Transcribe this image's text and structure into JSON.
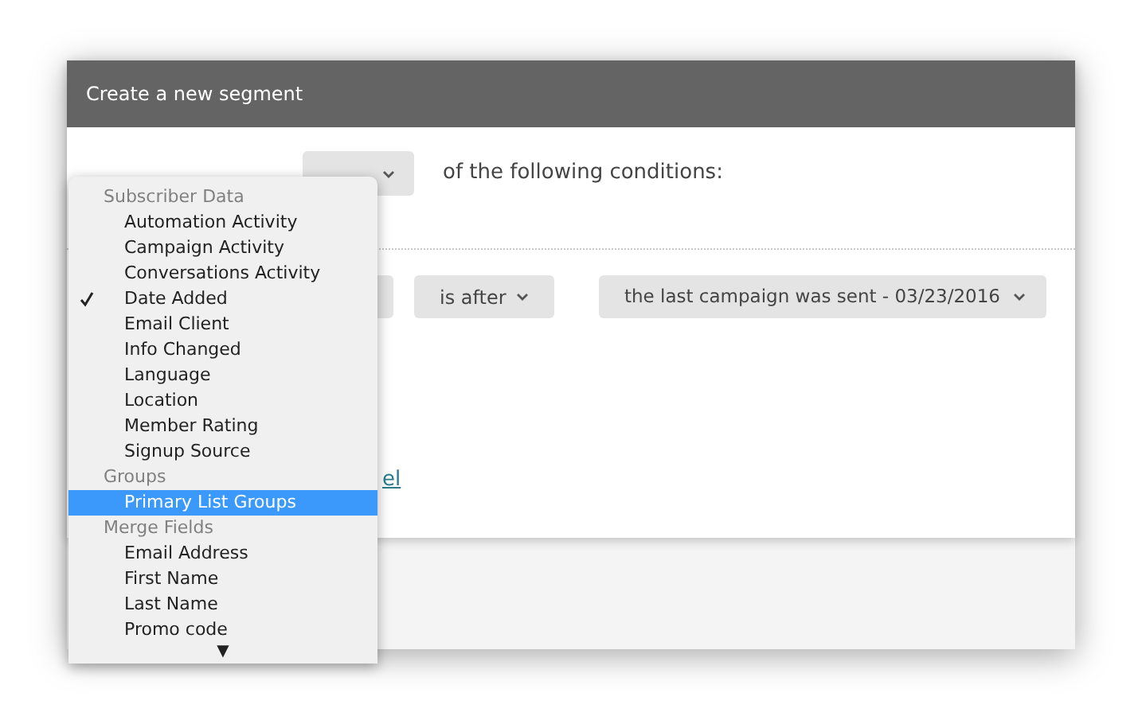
{
  "window": {
    "title": "Create a new segment"
  },
  "match_row": {
    "text": "of the following conditions:"
  },
  "condition": {
    "operator": "is after",
    "value": "the last campaign was sent - 03/23/2016"
  },
  "cancel_link": {
    "label": "el"
  },
  "menu": {
    "groups": [
      {
        "label": "Subscriber Data",
        "items": [
          {
            "label": "Automation Activity",
            "checked": false,
            "selected": false
          },
          {
            "label": "Campaign Activity",
            "checked": false,
            "selected": false
          },
          {
            "label": "Conversations Activity",
            "checked": false,
            "selected": false
          },
          {
            "label": "Date Added",
            "checked": true,
            "selected": false
          },
          {
            "label": "Email Client",
            "checked": false,
            "selected": false
          },
          {
            "label": "Info Changed",
            "checked": false,
            "selected": false
          },
          {
            "label": "Language",
            "checked": false,
            "selected": false
          },
          {
            "label": "Location",
            "checked": false,
            "selected": false
          },
          {
            "label": "Member Rating",
            "checked": false,
            "selected": false
          },
          {
            "label": "Signup Source",
            "checked": false,
            "selected": false
          }
        ]
      },
      {
        "label": "Groups",
        "items": [
          {
            "label": "Primary List Groups",
            "checked": false,
            "selected": true
          }
        ]
      },
      {
        "label": "Merge Fields",
        "items": [
          {
            "label": "Email Address",
            "checked": false,
            "selected": false
          },
          {
            "label": "First Name",
            "checked": false,
            "selected": false
          },
          {
            "label": "Last Name",
            "checked": false,
            "selected": false
          },
          {
            "label": "Promo code",
            "checked": false,
            "selected": false
          }
        ]
      }
    ],
    "scroll_arrow": "▼"
  }
}
